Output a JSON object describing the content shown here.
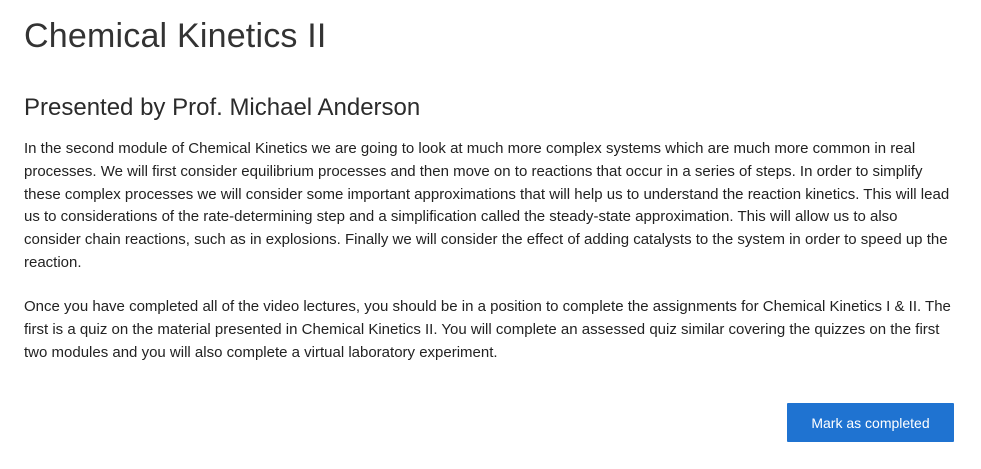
{
  "lesson": {
    "title": "Chemical Kinetics II",
    "presenter": "Presented by Prof. Michael Anderson",
    "paragraphs": [
      "In the second module of Chemical Kinetics we are going to look at much more complex systems which are much more common in real processes. We will first consider equilibrium processes and then move on to reactions that occur in a series of steps. In order to simplify these complex processes we will consider some important approximations that will help us to understand the reaction kinetics. This will lead us to considerations of the rate-determining step and a simplification called the steady-state approximation. This will allow us to also consider chain reactions, such as in explosions. Finally we will consider the effect of adding catalysts to the system in order to speed up the reaction.",
      "Once you have completed all of the video lectures, you should be in a position to complete the assignments for Chemical Kinetics I & II. The first is a quiz on the material presented in Chemical Kinetics II. You will complete an assessed quiz similar covering the quizzes on the first two modules and you will also complete a virtual laboratory experiment."
    ],
    "complete_button_label": "Mark as completed"
  },
  "colors": {
    "button_bg": "#1f73d1",
    "button_text": "#ffffff",
    "text": "#222222"
  }
}
